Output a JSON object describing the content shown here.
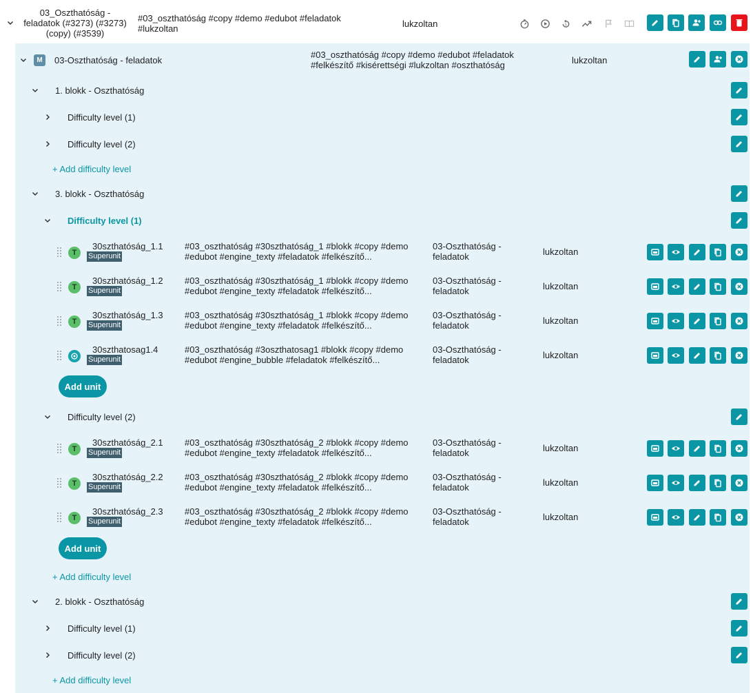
{
  "course": {
    "title": "03_Oszthatóság - feladatok (#3273) (#3273) (copy) (#3539)",
    "tags": "#03_oszthatóság #copy #demo #edubot #feladatok #lukzoltan",
    "owner": "lukzoltan"
  },
  "module": {
    "badge": "M",
    "title": "03-Oszthatóság - feladatok",
    "tags": "#03_oszthatóság #copy #demo #edubot #feladatok #felkészítő #kisérettségi #lukzoltan #oszthatóság",
    "owner": "lukzoltan"
  },
  "blocks": [
    {
      "title": "1. blokk - Oszthatóság",
      "levels": [
        "Difficulty level (1)",
        "Difficulty level (2)"
      ],
      "add_level": "+ Add difficulty level"
    },
    {
      "title": "3. blokk - Oszthatóság",
      "expanded_levels": [
        {
          "title": "Difficulty level (1)",
          "units": [
            {
              "badge": "T",
              "name": "30szthatóság_1.1",
              "tag": "Superunit",
              "tags": "#03_oszthatóság #30szthatóság_1 #blokk #copy #demo #edubot #engine_texty #feladatok #felkészítő...",
              "module": "03-Oszthatóság - feladatok",
              "owner": "lukzoltan"
            },
            {
              "badge": "T",
              "name": "30szthatóság_1.2",
              "tag": "Superunit",
              "tags": "#03_oszthatóság #30szthatóság_1 #blokk #copy #demo #edubot #engine_texty #feladatok #felkészítő...",
              "module": "03-Oszthatóság - feladatok",
              "owner": "lukzoltan"
            },
            {
              "badge": "T",
              "name": "30szthatóság_1.3",
              "tag": "Superunit",
              "tags": "#03_oszthatóság #30szthatóság_1 #blokk #copy #demo #edubot #engine_texty #feladatok #felkészítő...",
              "module": "03-Oszthatóság - feladatok",
              "owner": "lukzoltan"
            },
            {
              "badge": "bubble",
              "name": "30szthatosag1.4",
              "tag": "Superunit",
              "tags": "#03_oszthatóság #3oszthatosag1 #blokk #copy #demo #edubot #engine_bubble #feladatok #felkészítő...",
              "module": "03-Oszthatóság - feladatok",
              "owner": "lukzoltan"
            }
          ]
        },
        {
          "title": "Difficulty level (2)",
          "units": [
            {
              "badge": "T",
              "name": "30szthatóság_2.1",
              "tag": "Superunit",
              "tags": "#03_oszthatóság #30szthatóság_2 #blokk #copy #demo #edubot #engine_texty #feladatok #felkészítő...",
              "module": "03-Oszthatóság - feladatok",
              "owner": "lukzoltan"
            },
            {
              "badge": "T",
              "name": "30szthatóság_2.2",
              "tag": "Superunit",
              "tags": "#03_oszthatóság #30szthatóság_2 #blokk #copy #demo #edubot #engine_texty #feladatok #felkészítő...",
              "module": "03-Oszthatóság - feladatok",
              "owner": "lukzoltan"
            },
            {
              "badge": "T",
              "name": "30szthatóság_2.3",
              "tag": "Superunit",
              "tags": "#03_oszthatóság #30szthatóság_2 #blokk #copy #demo #edubot #engine_texty #feladatok #felkészítő...",
              "module": "03-Oszthatóság - feladatok",
              "owner": "lukzoltan"
            }
          ]
        }
      ],
      "add_unit": "Add unit",
      "add_level": "+ Add difficulty level"
    },
    {
      "title": "2. blokk - Oszthatóság",
      "levels": [
        "Difficulty level (1)",
        "Difficulty level (2)"
      ],
      "add_level": "+ Add difficulty level"
    }
  ],
  "icons": {
    "course_status": [
      "timer-icon",
      "play-circle-icon",
      "restart-icon",
      "trending-up-icon",
      "flag-icon",
      "book-icon"
    ],
    "course_actions": [
      "edit-icon",
      "copy-icon",
      "assign-user-icon",
      "link-icon",
      "delete-icon"
    ],
    "module_actions": [
      "edit-icon",
      "assign-user-icon",
      "close-icon"
    ],
    "unit_actions": [
      "preview-window-icon",
      "eye-icon",
      "edit-icon",
      "copy-icon",
      "close-icon"
    ]
  },
  "colors": {
    "accent": "#0a96a5",
    "danger": "#e8141b",
    "panel_bg": "#e6f3f8",
    "texty_badge": "#5bbf6a",
    "superunit_tag": "#3f5f6f",
    "module_badge": "#5f8ea6"
  }
}
